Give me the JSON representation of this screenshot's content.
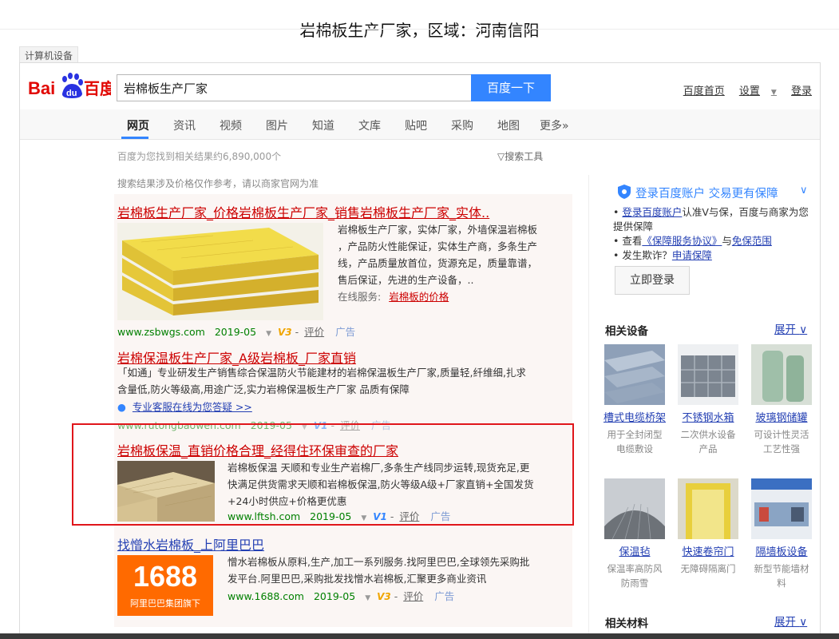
{
  "page_title": "岩棉板生产厂家，区域：河南信阳",
  "tab_label": "计算机设备",
  "search": {
    "query": "岩棉板生产厂家",
    "button": "百度一下"
  },
  "logo": {
    "bai": "Bai",
    "du": "du",
    "cn": "百度"
  },
  "top_links": {
    "home": "百度首页",
    "settings": "设置",
    "login": "登录"
  },
  "nav": [
    "网页",
    "资讯",
    "视频",
    "图片",
    "知道",
    "文库",
    "贴吧",
    "采购",
    "地图",
    "更多»"
  ],
  "result_stats": "百度为您找到相关结果约6,890,000个",
  "search_tools": "搜索工具",
  "price_note": "搜索结果涉及价格仅作参考，请以商家官网为准",
  "results": [
    {
      "title": "岩棉板生产厂家_价格岩棉板生产厂家_销售岩棉板生产厂家_实体..",
      "text_lines": [
        "岩棉板生产厂家，实体厂家，外墙保温岩棉板",
        "，产品防火性能保证，实体生产商，多条生产",
        "线，产品质量放首位，货源充足，质量靠谱，",
        "售后保证，先进的生产设备，.."
      ],
      "service_label": "在线服务:",
      "service_link": "岩棉板的价格",
      "url": "www.zsbwgs.com",
      "date": "2019-05",
      "badge": "V3",
      "eval": "评价",
      "ad": "广告"
    },
    {
      "title": "岩棉保温板生产厂家_A级岩棉板_厂家直销",
      "text_lines": [
        "「如通」专业研发生产销售综合保温防火节能建材的岩棉保温板生产厂家,质量轻,纤维细,扎求",
        "含量低,防火等级高,用途广泛,实力岩棉保温板生产厂家 品质有保障"
      ],
      "chat_link": "专业客服在线为您答疑 >>",
      "url": "www.rutongbaowen.com",
      "date": "2019-05",
      "badge": "V1",
      "eval": "评价",
      "ad": "广告"
    },
    {
      "title": "岩棉板保温_直销价格合理_经得住环保审查的厂家",
      "text_lines": [
        "岩棉板保温 天顺和专业生产岩棉厂,多条生产线同步运转,现货充足,更",
        "快满足供货需求天顺和岩棉板保温,防火等级A级+厂家直销+全国发货",
        "+24小时供应+价格更优惠"
      ],
      "url": "www.lftsh.com",
      "date": "2019-05",
      "badge": "V1",
      "eval": "评价",
      "ad": "广告"
    },
    {
      "title": "找憎水岩棉板_上阿里巴巴",
      "text_lines": [
        "憎水岩棉板从原料,生产,加工一系列服务.找阿里巴巴,全球领先采购批",
        "发平台.阿里巴巴,采购批发找憎水岩棉板,汇聚更多商业资讯"
      ],
      "logo_num": "1688",
      "logo_sub": "阿里巴巴集团旗下",
      "url": "www.1688.com",
      "date": "2019-05",
      "badge": "V3",
      "eval": "评价",
      "ad": "广告"
    }
  ],
  "right": {
    "login_title": "登录百度账户 交易更有保障",
    "login_lines": [
      {
        "pre": "• ",
        "link": "登录百度账户",
        "post": "认准V与保，百度与商家为您提供保障"
      },
      {
        "pre": "• 查看",
        "link": "《保障服务协议》",
        "mid": "与",
        "link2": "免保范围",
        "post": ""
      },
      {
        "pre": "• 发生欺诈？",
        "link": "申请保障",
        "post": ""
      }
    ],
    "login_button": "立即登录",
    "related_equipment": "相关设备",
    "expand": "展开",
    "equipment": [
      {
        "name": "槽式电缆桥架",
        "desc": "用于全封闭型电缆敷设"
      },
      {
        "name": "不锈钢水箱",
        "desc": "二次供水设备产品"
      },
      {
        "name": "玻璃钢储罐",
        "desc": "可设计性灵活工艺性强"
      },
      {
        "name": "保温毡",
        "desc": "保温率高防风防雨雪"
      },
      {
        "name": "快速卷帘门",
        "desc": "无障碍隔离门"
      },
      {
        "name": "隔墙板设备",
        "desc": "新型节能墙材料"
      }
    ],
    "related_materials": "相关材料",
    "expand2": "展开"
  }
}
